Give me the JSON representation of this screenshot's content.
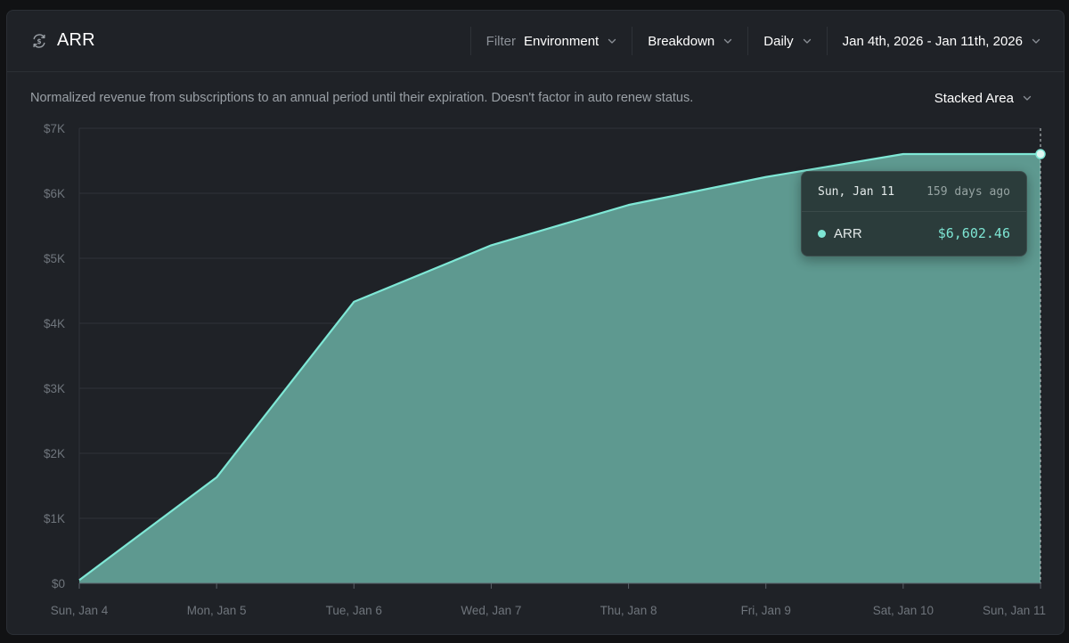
{
  "header": {
    "title": "ARR",
    "icon": "revenue-cycle-icon",
    "filter_label": "Filter",
    "filter_value": "Environment",
    "breakdown_label": "Breakdown",
    "interval_label": "Daily",
    "date_range": "Jan 4th, 2026 - Jan 11th, 2026"
  },
  "description": "Normalized revenue from subscriptions to an annual period until their expiration. Doesn't factor in auto renew status.",
  "chart_type_label": "Stacked Area",
  "colors": {
    "line": "#7fe8d6",
    "fill": "#5e9990",
    "background": "#1f2227",
    "grid": "#2f3339"
  },
  "tooltip": {
    "date": "Sun, Jan 11",
    "ago": "159 days ago",
    "series": "ARR",
    "value": "$6,602.46"
  },
  "chart_data": {
    "type": "area",
    "categories": [
      "Sun, Jan 4",
      "Mon, Jan 5",
      "Tue, Jan 6",
      "Wed, Jan 7",
      "Thu, Jan 8",
      "Fri, Jan 9",
      "Sat, Jan 10",
      "Sun, Jan 11"
    ],
    "series": [
      {
        "name": "ARR",
        "values": [
          50,
          1630,
          4330,
          5200,
          5820,
          6250,
          6602.46,
          6602.46
        ]
      }
    ],
    "ylim": [
      0,
      7000
    ],
    "yticks": [
      0,
      1000,
      2000,
      3000,
      4000,
      5000,
      6000,
      7000
    ],
    "ytick_labels": [
      "$0",
      "$1K",
      "$2K",
      "$3K",
      "$4K",
      "$5K",
      "$6K",
      "$7K"
    ],
    "grid": true,
    "stacked": true,
    "highlight_index": 7
  }
}
